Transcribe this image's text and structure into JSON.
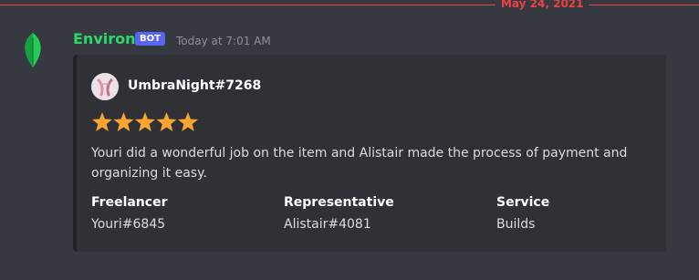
{
  "divider": {
    "date": "May 24, 2021"
  },
  "message": {
    "username": "Environ",
    "bot_tag": "BOT",
    "timestamp": "Today at 7:01 AM",
    "avatar_icon": "leaf-icon"
  },
  "embed": {
    "author": "UmbraNight#7268",
    "author_avatar_icon": "user-avatar",
    "rating": 5,
    "rating_max": 5,
    "description": "Youri did a wonderful job on the item and Alistair made the process of payment and organizing it easy.",
    "fields": [
      {
        "name": "Freelancer",
        "value": "Youri#6845"
      },
      {
        "name": "Representative",
        "value": "Alistair#4081"
      },
      {
        "name": "Service",
        "value": "Builds"
      }
    ]
  },
  "colors": {
    "background": "#36393f",
    "embed_background": "#2f3136",
    "username": "#2bd96b",
    "bot_tag": "#5865f2",
    "divider": "#ed4245",
    "star": "#f8a532"
  }
}
